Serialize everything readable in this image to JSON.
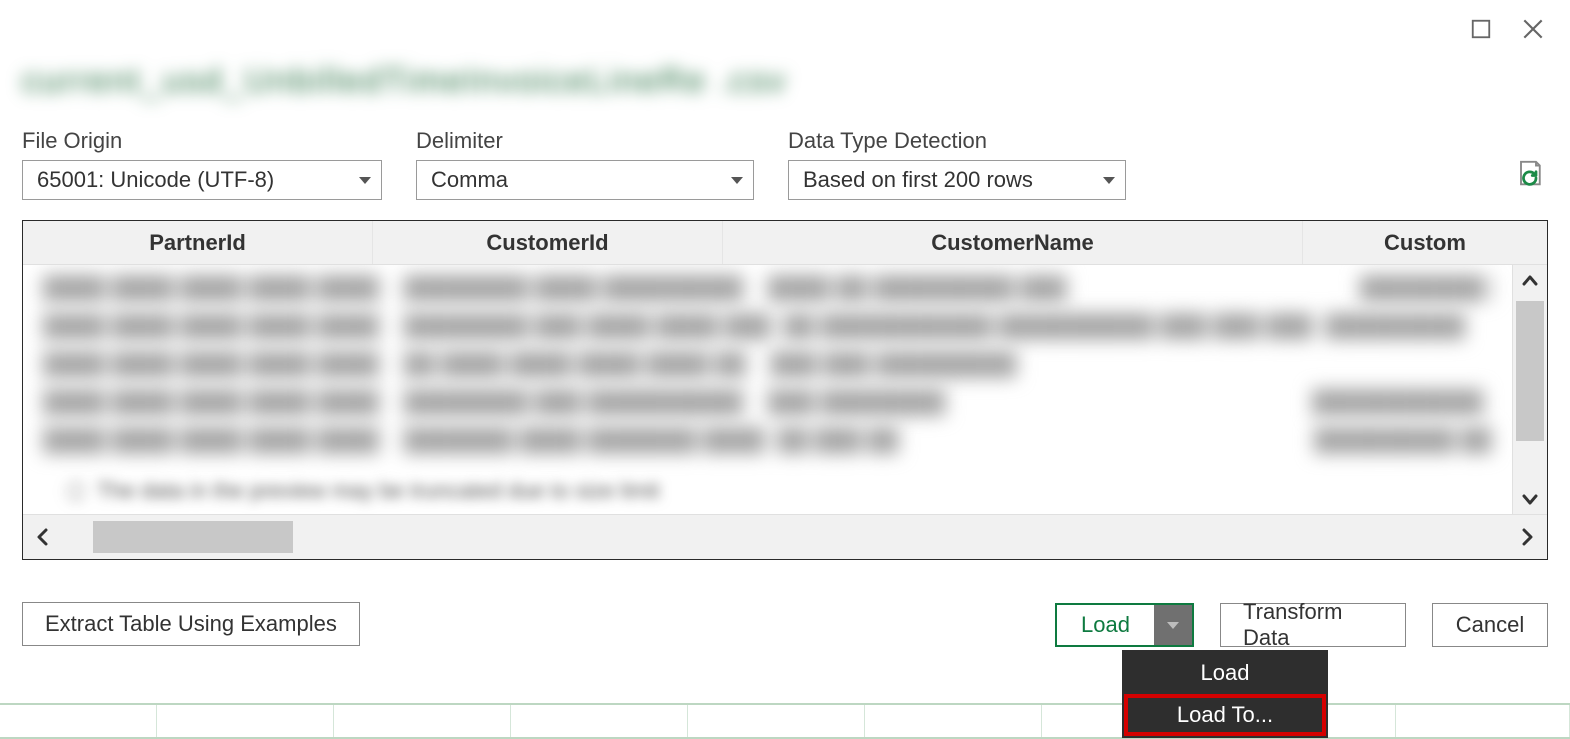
{
  "titlebar": {
    "maximize_tooltip": "Maximize",
    "close_tooltip": "Close"
  },
  "file_title_blurred": "current_usd_UnbilledTimeInvoiceLineRe .csv",
  "options": {
    "file_origin": {
      "label": "File Origin",
      "value": "65001: Unicode (UTF-8)"
    },
    "delimiter": {
      "label": "Delimiter",
      "value": "Comma"
    },
    "detection": {
      "label": "Data Type Detection",
      "value": "Based on first 200 rows"
    }
  },
  "table": {
    "columns": [
      "PartnerId",
      "CustomerId",
      "CustomerName",
      "Custom"
    ],
    "rows": [
      [
        "████ ████ ████ ████ ████",
        "████████ ████ █████████",
        "████ ██ █████████ ███",
        "████████ ██"
      ],
      [
        "████ ████ ████ ████ ████",
        "████████ ███ ████ ████ ███",
        "██ ███████████ ██████████ ███ ███ ███",
        "█████████"
      ],
      [
        "████ ████ ████ ████ ████",
        "██ ████ ████ ████ ████ ██",
        "███ ███ █████████",
        ""
      ],
      [
        "████ ████ ████ ████ ████",
        "████████ ███ ██████████",
        "███ ████████",
        "███████████"
      ],
      [
        "████ ████ ████ ████ ████",
        "███████ ████ ███████ ████",
        "██ ███ ██",
        "█████████ ██"
      ]
    ],
    "info_text": "The data in the preview may be truncated due to size limit"
  },
  "buttons": {
    "extract": "Extract Table Using Examples",
    "load": "Load",
    "transform": "Transform Data",
    "cancel": "Cancel"
  },
  "menu": {
    "load": "Load",
    "load_to": "Load To..."
  },
  "colors": {
    "accent_green": "#0e7a40",
    "highlight_red": "#d40000",
    "menu_bg": "#2e2e2e"
  }
}
